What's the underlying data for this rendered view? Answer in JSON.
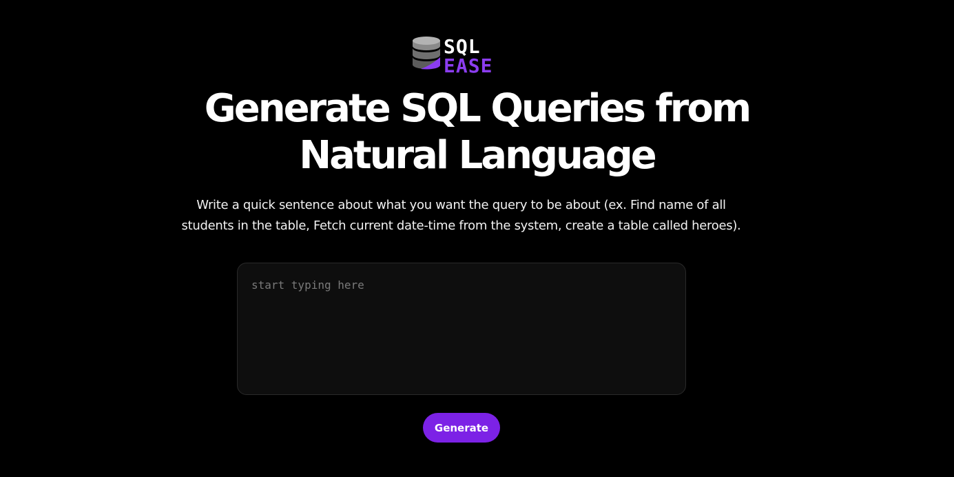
{
  "logo": {
    "word_top": "SQL",
    "word_bottom": "EASE",
    "icon": "database-icon",
    "colors": {
      "primary": "#ffffff",
      "accent": "#8b3df0",
      "icon_gray": "#8a8a8a"
    }
  },
  "hero": {
    "title_line1": "Generate SQL Queries from",
    "title_line2": "Natural Language",
    "subtitle_line1": "Write a quick sentence about what you want the query to be about (ex. Find name of all",
    "subtitle_line2": "students in the table, Fetch current date-time from the system, create a table called heroes)."
  },
  "input": {
    "placeholder": "start typing here",
    "value": ""
  },
  "actions": {
    "generate_label": "Generate",
    "accent_color": "#7c22e6"
  }
}
